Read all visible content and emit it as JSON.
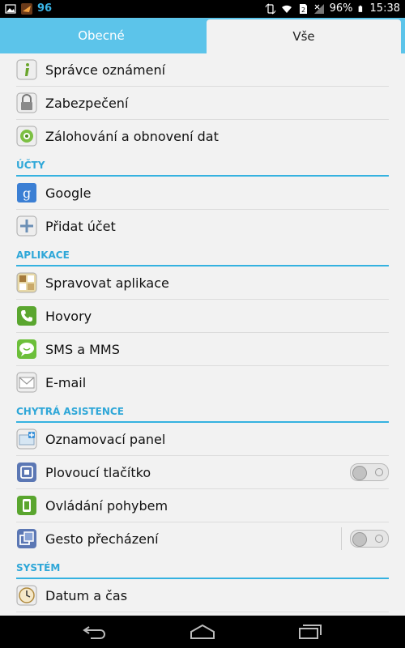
{
  "status_bar": {
    "notification_count": "96",
    "battery": "96%",
    "time": "15:38"
  },
  "tabs": [
    {
      "label": "Obecné"
    },
    {
      "label": "Vše"
    }
  ],
  "items": {
    "notifications": "Správce oznámení",
    "security": "Zabezpečení",
    "backup": "Zálohování a obnovení dat",
    "section_accounts": "ÚČTY",
    "google": "Google",
    "add_account": "Přidat účet",
    "section_apps": "APLIKACE",
    "manage_apps": "Spravovat aplikace",
    "calls": "Hovory",
    "sms": "SMS a MMS",
    "email": "E-mail",
    "section_assist": "CHYTRÁ ASISTENCE",
    "notification_panel": "Oznamovací panel",
    "floating_button": "Plovoucí tlačítko",
    "motion_control": "Ovládání pohybem",
    "gesture": "Gesto přecházení",
    "section_system": "SYSTÉM",
    "date_time": "Datum a čas"
  },
  "toggles": {
    "floating_button": false,
    "gesture": false
  },
  "colors": {
    "accent": "#35b2e0",
    "tab_bar": "#5cc4ea"
  }
}
